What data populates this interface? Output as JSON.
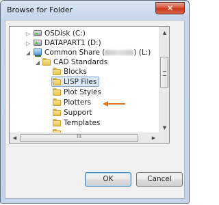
{
  "window": {
    "title": "Browse for Folder",
    "close_label": "✕"
  },
  "tree": {
    "items": [
      {
        "label": "OSDisk (C:)",
        "expander": "▷"
      },
      {
        "label": "DATAPART1 (D:)",
        "expander": "▷"
      },
      {
        "label_prefix": "Common Share (",
        "label_suffix": ") (L:)",
        "expander": "◢"
      },
      {
        "label": "CAD Standards",
        "expander": "◢"
      },
      {
        "label": "Blocks"
      },
      {
        "label": "LISP Files",
        "selected": true
      },
      {
        "label": "Plot Styles"
      },
      {
        "label": "Plotters"
      },
      {
        "label": "Support"
      },
      {
        "label": "Templates"
      }
    ]
  },
  "scrollbars": {
    "up": "▲",
    "down": "▼",
    "left": "◀",
    "right": "▶",
    "h_thumb_label": "III"
  },
  "buttons": {
    "ok": "OK",
    "cancel": "Cancel"
  },
  "colors": {
    "annotation_arrow": "#e0771f",
    "selection": "#dcebfc"
  }
}
